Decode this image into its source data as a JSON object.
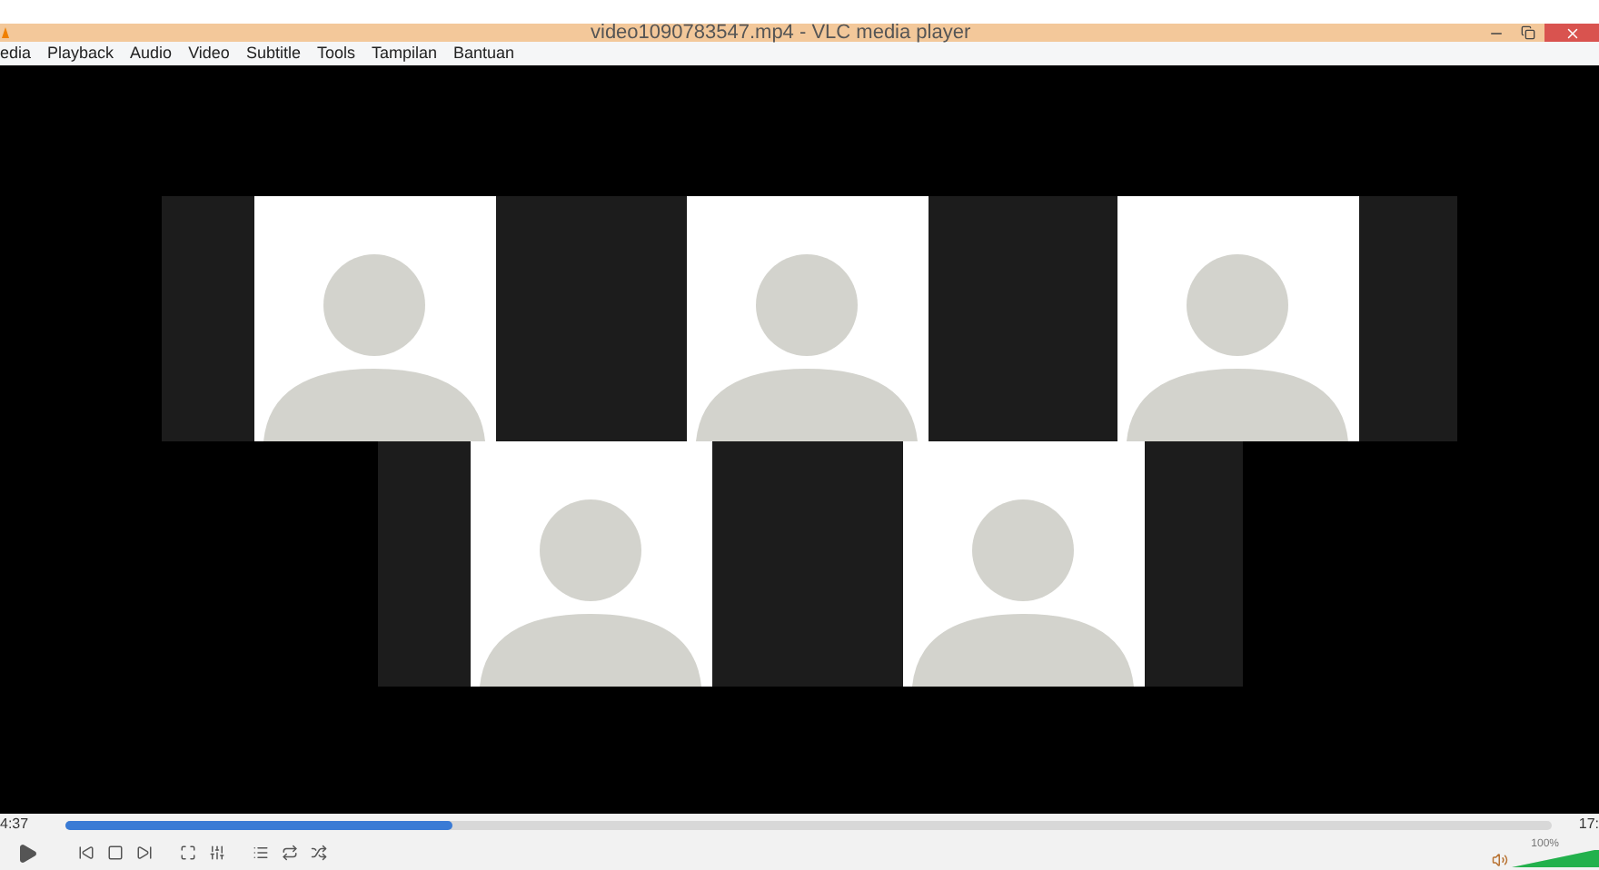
{
  "window": {
    "title": "video1090783547.mp4 - VLC media player"
  },
  "menu": [
    "edia",
    "Playback",
    "Audio",
    "Video",
    "Subtitle",
    "Tools",
    "Tampilan",
    "Bantuan"
  ],
  "seek": {
    "elapsed": "4:37",
    "total": "17:",
    "level": 0.26
  },
  "volume": {
    "reading": "100%",
    "level": 1
  }
}
